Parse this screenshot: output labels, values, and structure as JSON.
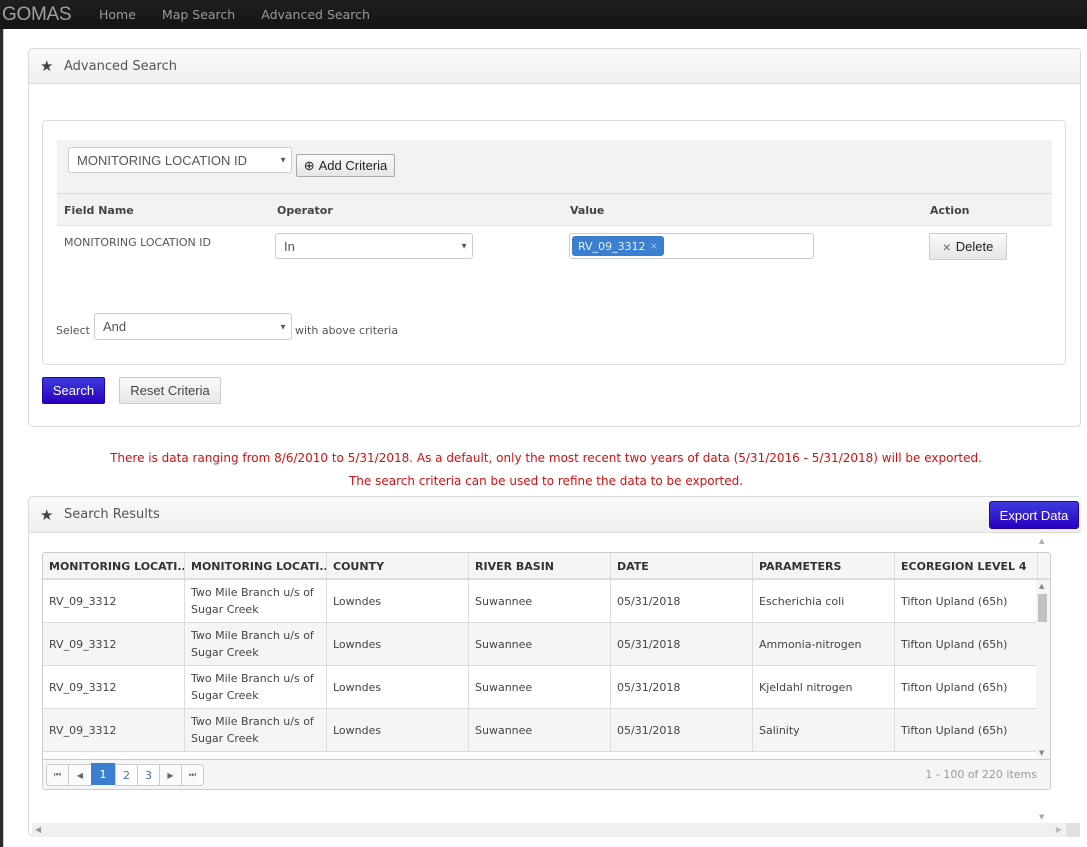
{
  "navbar": {
    "brand": "GOMAS",
    "links": [
      "Home",
      "Map Search",
      "Advanced Search"
    ]
  },
  "advanced_search": {
    "title": "Advanced Search",
    "field_select": "MONITORING LOCATION ID",
    "add_criteria_label": "Add Criteria",
    "columns": [
      "Field Name",
      "Operator",
      "Value",
      "Action"
    ],
    "criteria": [
      {
        "field": "MONITORING LOCATION ID",
        "operator": "In",
        "values": [
          "RV_09_3312"
        ],
        "action_label": "Delete"
      }
    ],
    "select_label": "Select",
    "logic_value": "And",
    "logic_suffix": "with above criteria",
    "search_label": "Search",
    "reset_label": "Reset Criteria"
  },
  "notice": {
    "line1": "There is data ranging from 8/6/2010 to 5/31/2018. As a default, only the most recent two years of data (5/31/2016 - 5/31/2018) will be exported.",
    "line2": "The search criteria can be used to refine the data to be exported.",
    "color": "#d01010"
  },
  "results": {
    "title": "Search Results",
    "export_label": "Export Data",
    "columns": [
      "MONITORING LOCATI...",
      "MONITORING LOCATI...",
      "COUNTY",
      "RIVER BASIN",
      "DATE",
      "PARAMETERS",
      "ECOREGION LEVEL 4"
    ],
    "rows": [
      [
        "RV_09_3312",
        "Two Mile Branch u/s of Sugar Creek",
        "Lowndes",
        "Suwannee",
        "05/31/2018",
        "Escherichia coli",
        "Tifton Upland (65h)"
      ],
      [
        "RV_09_3312",
        "Two Mile Branch u/s of Sugar Creek",
        "Lowndes",
        "Suwannee",
        "05/31/2018",
        "Ammonia-nitrogen",
        "Tifton Upland (65h)"
      ],
      [
        "RV_09_3312",
        "Two Mile Branch u/s of Sugar Creek",
        "Lowndes",
        "Suwannee",
        "05/31/2018",
        "Kjeldahl nitrogen",
        "Tifton Upland (65h)"
      ],
      [
        "RV_09_3312",
        "Two Mile Branch u/s of Sugar Creek",
        "Lowndes",
        "Suwannee",
        "05/31/2018",
        "Salinity",
        "Tifton Upland (65h)"
      ]
    ],
    "pager": {
      "pages": [
        "1",
        "2",
        "3"
      ],
      "current": "1",
      "info": "1 - 100 of 220 items"
    }
  },
  "icons": {
    "star": "★",
    "plus_circle": "⊕",
    "close": "×",
    "caret_down": "▼",
    "first": "⏮",
    "prev": "◀",
    "next": "▶",
    "last": "⏭"
  }
}
